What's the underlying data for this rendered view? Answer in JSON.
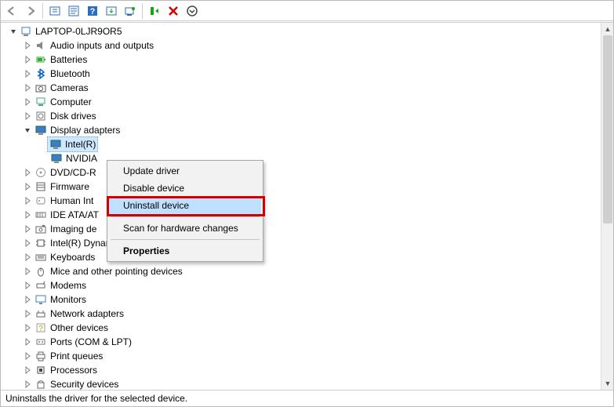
{
  "toolbar": {
    "icons": [
      "back-arrow",
      "forward-arrow",
      "show-hidden",
      "properties",
      "help",
      "update-driver",
      "scan-hardware",
      "uninstall-device",
      "action-x",
      "more"
    ]
  },
  "tree": {
    "root_label": "LAPTOP-0LJR9OR5",
    "items": [
      {
        "label": "Audio inputs and outputs",
        "icon": "audio",
        "exp": "closed",
        "depth": 1
      },
      {
        "label": "Batteries",
        "icon": "battery",
        "exp": "closed",
        "depth": 1
      },
      {
        "label": "Bluetooth",
        "icon": "bluetooth",
        "exp": "closed",
        "depth": 1
      },
      {
        "label": "Cameras",
        "icon": "camera",
        "exp": "closed",
        "depth": 1
      },
      {
        "label": "Computer",
        "icon": "computer",
        "exp": "closed",
        "depth": 1
      },
      {
        "label": "Disk drives",
        "icon": "disk",
        "exp": "closed",
        "depth": 1
      },
      {
        "label": "Display adapters",
        "icon": "display",
        "exp": "open",
        "depth": 1
      },
      {
        "label": "Intel(R)",
        "icon": "display",
        "exp": "none",
        "depth": 2,
        "selected": true
      },
      {
        "label": "NVIDIA",
        "icon": "display",
        "exp": "none",
        "depth": 2
      },
      {
        "label": "DVD/CD-R",
        "icon": "dvd",
        "exp": "closed",
        "depth": 1,
        "truncated": true
      },
      {
        "label": "Firmware",
        "icon": "firmware",
        "exp": "closed",
        "depth": 1
      },
      {
        "label": "Human Int",
        "icon": "hid",
        "exp": "closed",
        "depth": 1,
        "truncated": true
      },
      {
        "label": "IDE ATA/AT",
        "icon": "ide",
        "exp": "closed",
        "depth": 1,
        "truncated": true
      },
      {
        "label": "Imaging de",
        "icon": "imaging",
        "exp": "closed",
        "depth": 1,
        "truncated": true
      },
      {
        "label": "Intel(R) Dynamic Platform and Thermal Framework",
        "icon": "chip",
        "exp": "closed",
        "depth": 1
      },
      {
        "label": "Keyboards",
        "icon": "keyboard",
        "exp": "closed",
        "depth": 1
      },
      {
        "label": "Mice and other pointing devices",
        "icon": "mouse",
        "exp": "closed",
        "depth": 1
      },
      {
        "label": "Modems",
        "icon": "modem",
        "exp": "closed",
        "depth": 1
      },
      {
        "label": "Monitors",
        "icon": "monitor",
        "exp": "closed",
        "depth": 1
      },
      {
        "label": "Network adapters",
        "icon": "network",
        "exp": "closed",
        "depth": 1
      },
      {
        "label": "Other devices",
        "icon": "other",
        "exp": "closed",
        "depth": 1
      },
      {
        "label": "Ports (COM & LPT)",
        "icon": "port",
        "exp": "closed",
        "depth": 1
      },
      {
        "label": "Print queues",
        "icon": "printer",
        "exp": "closed",
        "depth": 1
      },
      {
        "label": "Processors",
        "icon": "cpu",
        "exp": "closed",
        "depth": 1
      },
      {
        "label": "Security devices",
        "icon": "security",
        "exp": "closed",
        "depth": 1
      }
    ]
  },
  "context_menu": {
    "items": [
      {
        "label": "Update driver",
        "type": "item"
      },
      {
        "label": "Disable device",
        "type": "item"
      },
      {
        "label": "Uninstall device",
        "type": "item",
        "highlighted": true
      },
      {
        "type": "sep"
      },
      {
        "label": "Scan for hardware changes",
        "type": "item"
      },
      {
        "type": "sep"
      },
      {
        "label": "Properties",
        "type": "item",
        "bold": true
      }
    ]
  },
  "statusbar": {
    "text": "Uninstalls the driver for the selected device."
  },
  "highlight_color": "#d40000"
}
